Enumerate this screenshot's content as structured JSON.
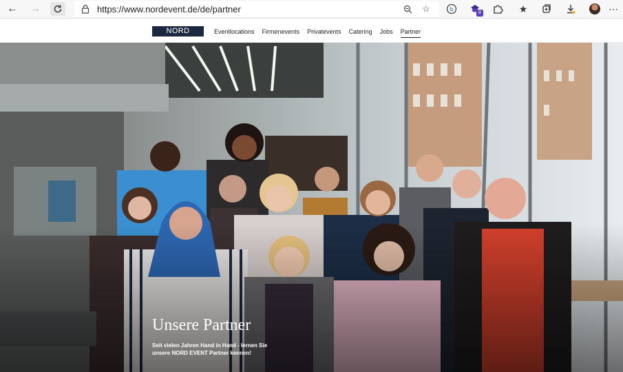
{
  "browser": {
    "url": "https://www.nordevent.de/de/partner",
    "extension_badge": "8"
  },
  "site": {
    "logo": "NORD EVENT",
    "nav": [
      {
        "label": "Eventlocations"
      },
      {
        "label": "Firmenevents"
      },
      {
        "label": "Privatevents"
      },
      {
        "label": "Catering"
      },
      {
        "label": "Jobs"
      },
      {
        "label": "Partner",
        "active": true
      }
    ]
  },
  "hero": {
    "title": "Unsere Partner",
    "subtitle_line1": "Seit vielen Jahren Hand in Hand - lernen Sie",
    "subtitle_line2": "unsere NORD EVENT Partner kennen!"
  },
  "colors": {
    "logo_bg": "#1c2840",
    "toolbar_bg": "#f7f7f7"
  },
  "icons": {
    "back": "arrow-left-icon",
    "forward": "arrow-right-icon",
    "refresh": "refresh-icon",
    "lock": "lock-icon",
    "zoom": "zoom-icon",
    "favorite_add": "star-plus-icon",
    "tracking": "tracking-prevention-icon",
    "extension": "extension-icon",
    "puzzle": "puzzle-icon",
    "favorites": "favorites-icon",
    "collections": "collections-icon",
    "download": "download-icon",
    "profile": "profile-avatar-icon",
    "more": "more-icon"
  }
}
